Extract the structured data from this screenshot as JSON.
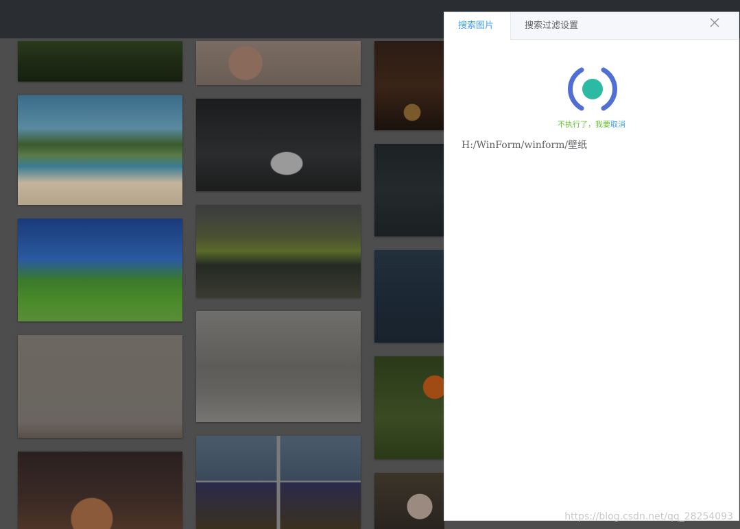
{
  "panel": {
    "tabs": [
      {
        "label": "搜索图片",
        "active": true
      },
      {
        "label": "搜索过滤设置",
        "active": false
      }
    ],
    "close_icon": "close-icon",
    "status_prefix": "不执行了，我要",
    "status_cancel": "取消",
    "path": "H:/WinForm/winform/壁纸",
    "colors": {
      "accent": "#409eff",
      "success": "#67c23a",
      "loader_outer": "#4f6fd4",
      "loader_inner": "#2dbaa3"
    }
  },
  "gallery": {
    "thumbnails": [
      "forest",
      "floral-painting",
      "beach",
      "sports-car",
      "green-hill",
      "mountain-lake-rainbow",
      "calendar-cartoon",
      "fashion-model",
      "anime-girl",
      "game-collage",
      "shelf-lantern",
      "rainy-water",
      "night-sea",
      "orange-flower",
      "anime-boy"
    ]
  },
  "watermark": "https://blog.csdn.net/qq_28254093"
}
